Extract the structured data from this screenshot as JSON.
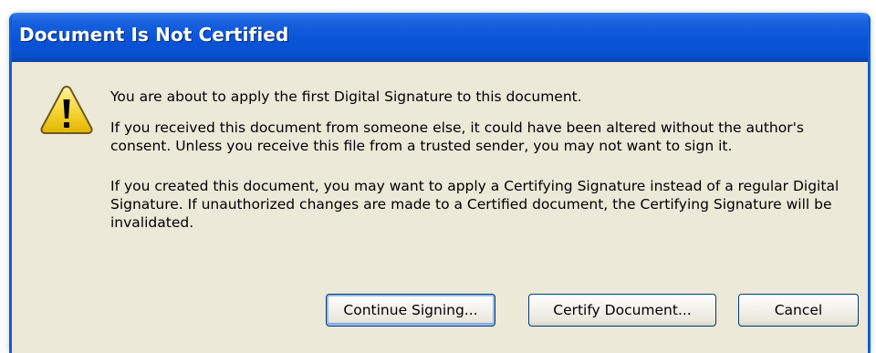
{
  "dialog": {
    "title": "Document Is Not Certified",
    "icon": "warning-triangle-icon",
    "messages": [
      "You are about to apply the first Digital Signature to this document.",
      "If you received this document from someone else, it could have been altered without the author's consent. Unless you receive this file from a trusted sender, you may not want to sign it.",
      "If you created this document, you may want to apply a Certifying Signature instead of a regular Digital Signature. If unauthorized changes are made to a Certified document, the Certifying Signature will be invalidated."
    ],
    "buttons": {
      "continue_label": "Continue Signing...",
      "certify_label": "Certify Document...",
      "cancel_label": "Cancel"
    },
    "colors": {
      "titlebar": "#0a55d8",
      "body": "#ece9d8",
      "icon_fill": "#f2d02a"
    }
  }
}
